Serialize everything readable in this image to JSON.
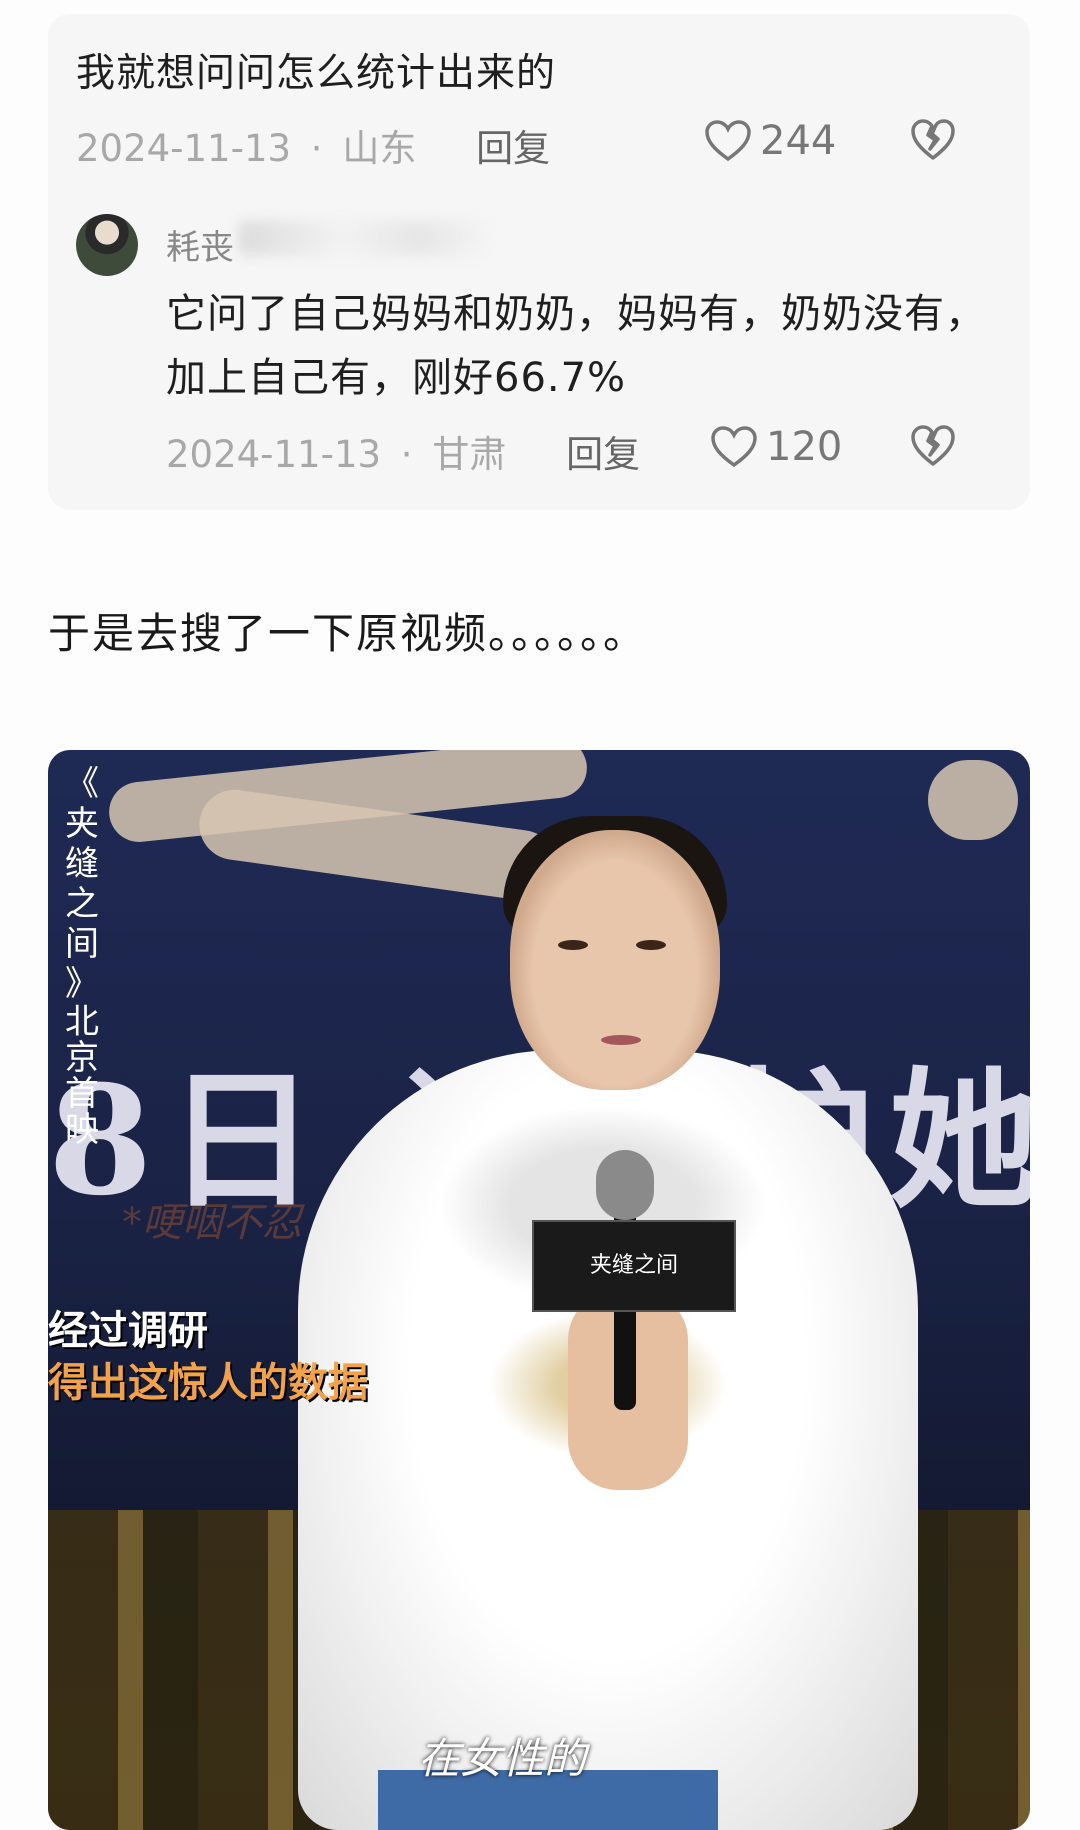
{
  "comment": {
    "text": "我就想问问怎么统计出来的",
    "date": "2024-11-13",
    "sep": "·",
    "region": "山东",
    "reply_label": "回复",
    "likes": "244"
  },
  "reply": {
    "username": "耗丧",
    "text": "它问了自己妈妈和奶奶，妈妈有，奶奶没有，加上自己有，刚好66.7%",
    "date": "2024-11-13",
    "sep": "·",
    "region": "甘肃",
    "reply_label": "回复",
    "likes": "120"
  },
  "caption": "于是去搜了一下原视频。。。。。。",
  "video": {
    "side_title": [
      "《",
      "夹",
      "缝",
      "之",
      "间",
      "》"
    ],
    "side_location": [
      "北",
      "京",
      "首",
      "映"
    ],
    "poster_text": "8日 谁来护她",
    "poster_sub": "*哽咽不忍",
    "mic_flag": "夹缝之间",
    "overlay_line1": "经过调研",
    "overlay_line2": "得出这惊人的数据",
    "subtitle": "在女性的"
  },
  "icons": {
    "like": "heart-outline-icon",
    "dislike": "broken-heart-icon"
  }
}
